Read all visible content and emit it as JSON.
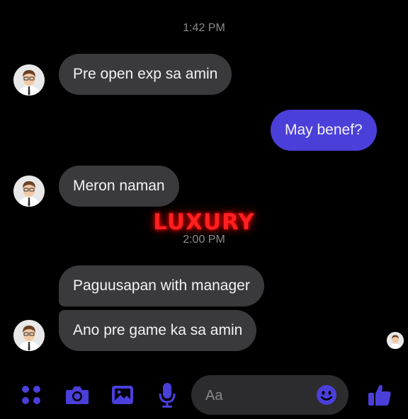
{
  "chat": {
    "timestamps": [
      "1:42 PM",
      "2:00 PM"
    ],
    "messages": [
      {
        "text": "Pre open exp sa amin",
        "direction": "incoming"
      },
      {
        "text": "May benef?",
        "direction": "outgoing"
      },
      {
        "text": "Meron naman",
        "direction": "incoming"
      },
      {
        "text": "Paguusapan with manager",
        "direction": "incoming"
      },
      {
        "text": "Ano pre game ka sa amin",
        "direction": "incoming"
      }
    ]
  },
  "watermark": "LUXURY",
  "composer": {
    "placeholder": "Aa"
  },
  "toolbar": {
    "icons": [
      "apps-grid-icon",
      "camera-icon",
      "gallery-icon",
      "microphone-icon",
      "emoji-icon",
      "thumbs-up-icon"
    ]
  },
  "colors": {
    "background": "#000000",
    "incoming_bubble": "#3a3a3c",
    "outgoing_bubble": "#4b3fd9",
    "accent": "#4b3fd9",
    "watermark": "#ff2020"
  }
}
